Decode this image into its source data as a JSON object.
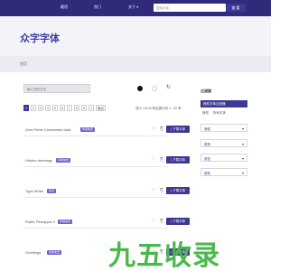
{
  "nav": {
    "items": [
      "藏馆",
      "热门",
      "关于 ▾"
    ]
  },
  "search": {
    "placeholder": "搜索字体",
    "button_label": "查 看"
  },
  "page": {
    "title": "众字字体",
    "breadcrumb": "首页"
  },
  "toolbar": {
    "text_placeholder": "输入您的文字",
    "color_dark": "#111111",
    "color_light": "#ffffff",
    "refresh_icon": "refresh-icon"
  },
  "pager": {
    "pages": [
      "1",
      "2",
      "3",
      "4",
      "5",
      "6",
      "7",
      "8",
      "9",
      "1",
      "最后"
    ],
    "active_index": 0,
    "count_text": "显示 14145 条结果中的 1 - 30 条"
  },
  "fonts": [
    {
      "name": "Zero Prime Condensed Italic",
      "badge": "商用免费"
    },
    {
      "name": "Hidden demimgs",
      "badge": "商用免费"
    },
    {
      "name": "Type Writer",
      "badge": "免费"
    },
    {
      "name": "Rutter Pineapple 2",
      "badge": "商用免费"
    },
    {
      "name": "Greetings",
      "badge": "商用免费"
    }
  ],
  "download_label": "⤓ 下载字体",
  "sidebar": {
    "title": "过滤器",
    "active_tab": "授权字体过滤器",
    "subtabs": [
      "授权",
      "所有字体"
    ],
    "filters": [
      "授权",
      "类别",
      "语言",
      "授权"
    ]
  },
  "watermark": {
    "text": "九五收录",
    "sub": ""
  },
  "colors": {
    "brand": "#3c3895",
    "topbar": "#2f2b7a",
    "badge": "#6b63c9",
    "watermark": "#4bb84b"
  }
}
